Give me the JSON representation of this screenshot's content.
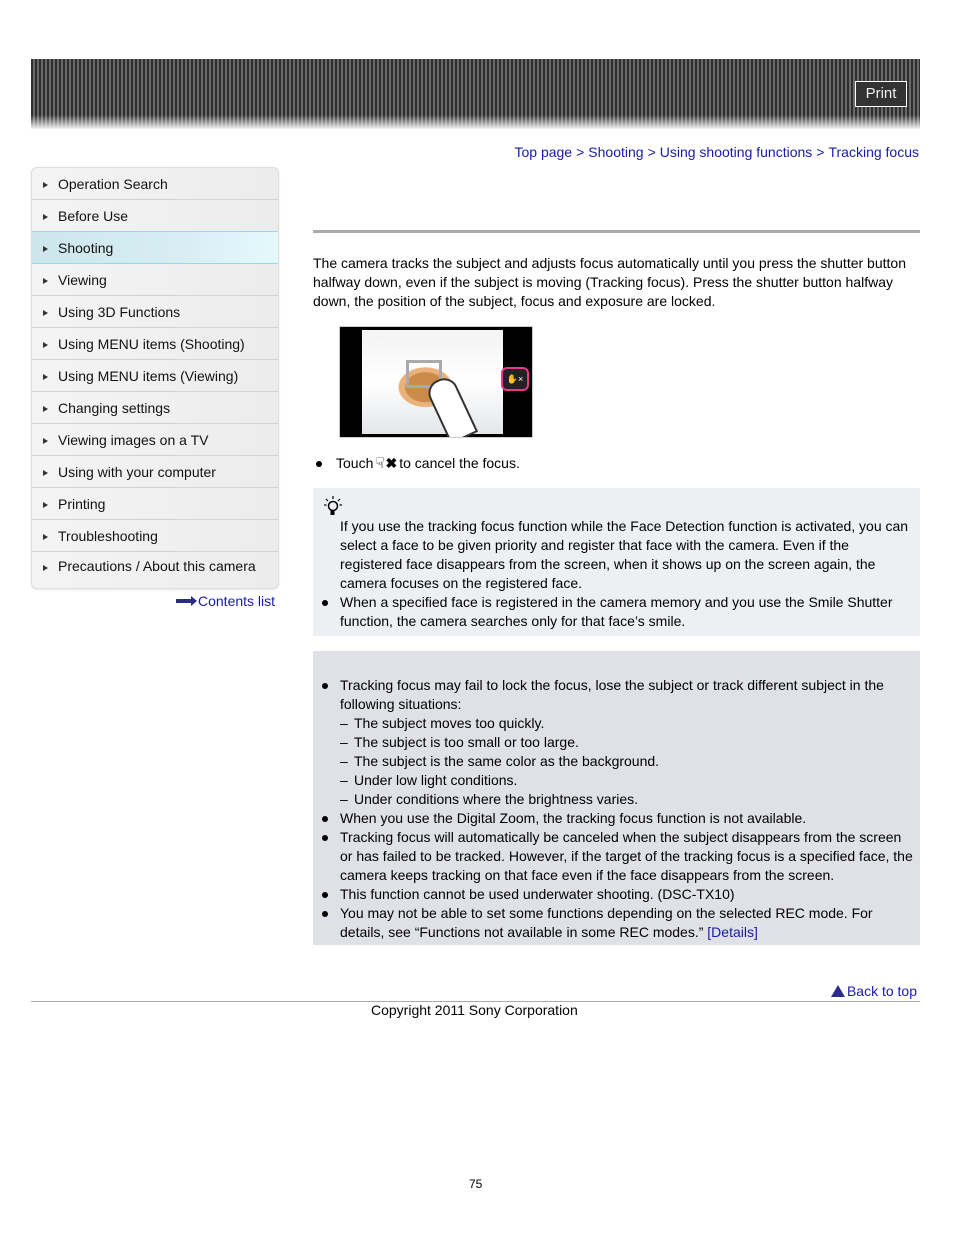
{
  "header": {
    "print_label": "Print"
  },
  "breadcrumb": {
    "items": [
      "Top page",
      "Shooting",
      "Using shooting functions",
      "Tracking focus"
    ],
    "separator": ">"
  },
  "sidebar": {
    "items": [
      {
        "label": "Operation Search",
        "active": false
      },
      {
        "label": "Before Use",
        "active": false
      },
      {
        "label": "Shooting",
        "active": true
      },
      {
        "label": "Viewing",
        "active": false
      },
      {
        "label": "Using 3D Functions",
        "active": false
      },
      {
        "label": "Using MENU items (Shooting)",
        "active": false
      },
      {
        "label": "Using MENU items (Viewing)",
        "active": false
      },
      {
        "label": "Changing settings",
        "active": false
      },
      {
        "label": "Viewing images on a TV",
        "active": false
      },
      {
        "label": "Using with your computer",
        "active": false
      },
      {
        "label": "Printing",
        "active": false
      },
      {
        "label": "Troubleshooting",
        "active": false
      },
      {
        "label": "Precautions / About this camera",
        "active": false
      }
    ],
    "contents_list_label": "Contents list"
  },
  "main": {
    "intro": "The camera tracks the subject and adjusts focus automatically until you press the shutter button halfway down, even if the subject is moving (Tracking focus). Press the shutter button halfway down, the position of the subject, focus and exposure are locked.",
    "touch_instruction": {
      "before": "Touch",
      "after": "to cancel the focus."
    },
    "hint": {
      "paragraph": "If you use the tracking focus function while the Face Detection function is activated, you can select a face to be given priority and register that face with the camera. Even if the registered face disappears from the screen, when it shows up on the screen again, the camera focuses on the registered face.",
      "bullet": "When a specified face is registered in the camera memory and you use the Smile Shutter function, the camera searches only for that face’s smile."
    },
    "notes": {
      "item1": "Tracking focus may fail to lock the focus, lose the subject or track different subject in the following situations:",
      "sub_items": [
        "The subject moves too quickly.",
        "The subject is too small or too large.",
        "The subject is the same color as the background.",
        "Under low light conditions.",
        "Under conditions where the brightness varies."
      ],
      "item2": "When you use the Digital Zoom, the tracking focus function is not available.",
      "item3": "Tracking focus will automatically be canceled when the subject disappears from the screen or has failed to be tracked. However, if the target of the tracking focus is a specified face, the camera keeps tracking on that face even if the face disappears from the screen.",
      "item4": "This function cannot be used underwater shooting. (DSC-TX10)",
      "item5_text": "You may not be able to set some functions depending on the selected REC mode. For details, see “Functions not available in some REC modes.”",
      "item5_link": "[Details]"
    }
  },
  "footer": {
    "back_to_top": "Back to top",
    "copyright": "Copyright 2011 Sony Corporation",
    "page_number": "75"
  },
  "colors": {
    "link": "#1a1aa6",
    "active_sidebar_border": "#8fdaf0",
    "hint_bg": "#edeff3",
    "note_bg": "#dfe1e6",
    "cancel_highlight": "#e8388e"
  }
}
